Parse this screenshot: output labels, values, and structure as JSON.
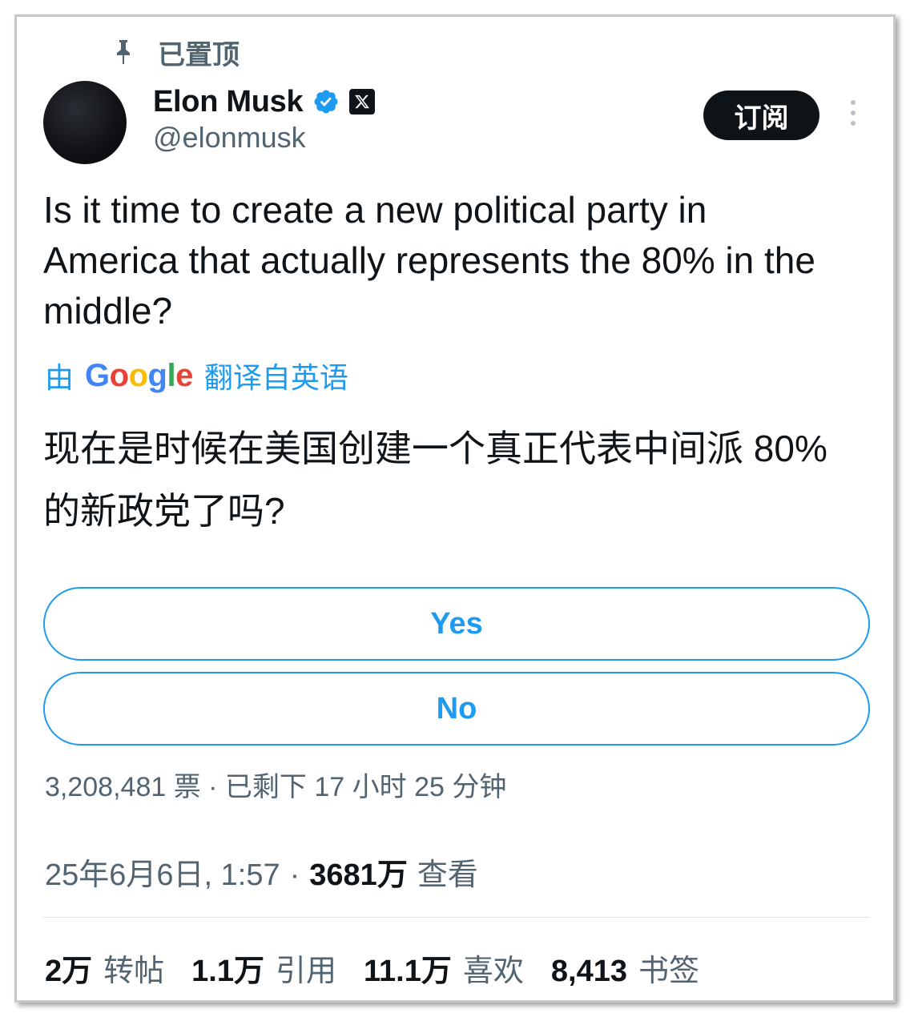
{
  "pinned": {
    "label": "已置顶",
    "icon": "pin-icon"
  },
  "author": {
    "display_name": "Elon Musk",
    "handle": "@elonmusk",
    "verified_icon": "verified-icon",
    "affiliate_icon": "x-logo-icon",
    "verified_color": "#1d9bf0"
  },
  "header": {
    "subscribe_label": "订阅",
    "more_icon": "more-vertical-icon"
  },
  "tweet": {
    "text": "Is it time to create a new political party in America that actually represents the 80% in the middle?",
    "translation_prefix": "由",
    "translation_provider": "Google",
    "translation_suffix": "翻译自英语",
    "translated_text": "现在是时候在美国创建一个真正代表中间派 80% 的新政党了吗?"
  },
  "poll": {
    "options": [
      {
        "label": "Yes"
      },
      {
        "label": "No"
      }
    ],
    "meta": "3,208,481 票 · 已剩下 17 小时 25 分钟",
    "accent_color": "#1d9bf0"
  },
  "timestamp": {
    "date": "25年6月6日, 1:57",
    "separator": "·",
    "views_count": "3681万",
    "views_label": "查看"
  },
  "stats": [
    {
      "count": "2万",
      "label": "转帖"
    },
    {
      "count": "1.1万",
      "label": "引用"
    },
    {
      "count": "11.1万",
      "label": "喜欢"
    },
    {
      "count": "8,413",
      "label": "书签"
    }
  ]
}
